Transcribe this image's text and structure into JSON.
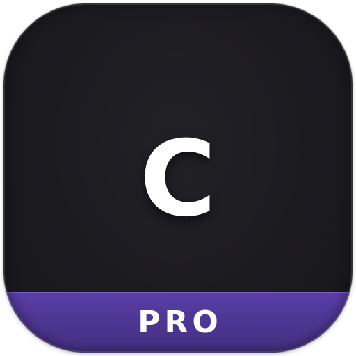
{
  "icon": {
    "letter": "C",
    "badge_label": "PRO",
    "colors": {
      "body": "#1c1b20",
      "badge_band": "#4f3796",
      "text": "#ffffff"
    }
  }
}
